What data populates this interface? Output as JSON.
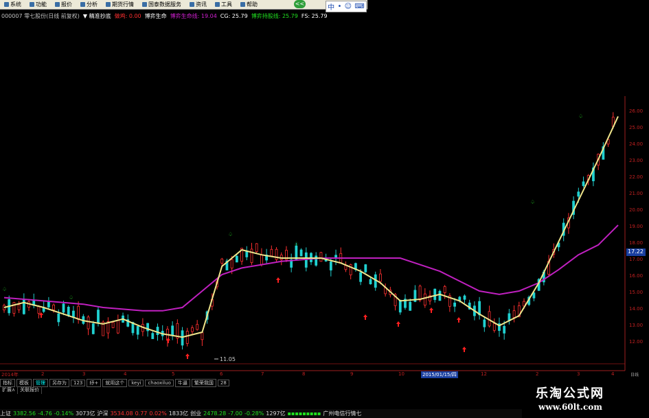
{
  "menu": {
    "items": [
      "系统",
      "功能",
      "报价",
      "分析",
      "期货行情",
      "国泰数据服务",
      "资讯",
      "工具",
      "帮助"
    ],
    "back_label": "<<",
    "ime": [
      "中",
      "•",
      "☺",
      "⌨"
    ]
  },
  "indicator_line": {
    "stock": "000007 零七股份(日线 前复权)",
    "items": [
      {
        "label": "▼ 精准抄底",
        "color": "#ffffff"
      },
      {
        "label": "做鸡: 0.00",
        "color": "#ff3030"
      },
      {
        "label": "博弈生命",
        "color": "#ffffff"
      },
      {
        "label": "博弈生命线: 19.04",
        "color": "#d020d0"
      },
      {
        "label": "CG: 25.79",
        "color": "#ffffff"
      },
      {
        "label": "博弈持股线: 25.79",
        "color": "#20e020"
      },
      {
        "label": "FS: 25.79",
        "color": "#ffffff"
      }
    ]
  },
  "price_axis": {
    "ticks": [
      "26.00",
      "25.00",
      "24.00",
      "23.00",
      "22.00",
      "21.00",
      "20.00",
      "19.00",
      "18.00",
      "17.00",
      "16.00",
      "15.00",
      "14.00",
      "13.00",
      "12.00"
    ],
    "current": "17.22"
  },
  "date_axis": {
    "labels": [
      "2014年",
      "2",
      "3",
      "4",
      "5",
      "6",
      "7",
      "8",
      "9",
      "10",
      "11",
      "12",
      "2",
      "3",
      "4"
    ],
    "cursor": "2015/01/15/四",
    "right": "日线"
  },
  "low_label": "11.05",
  "toolbar": {
    "items": [
      "指标",
      "模板",
      "管理",
      "另存为",
      "123",
      "纾+",
      "就用这个",
      "keyi",
      "chaoxiluo",
      "牛逼",
      "繁荣我国",
      "28"
    ],
    "selected": "管理"
  },
  "tabs2": [
    "扩展∧",
    "关联报价"
  ],
  "status": {
    "sh_label": "上证",
    "sh_val": "3382.56",
    "sh_chg": "-4.76",
    "sh_pct": "-0.14%",
    "sh_amt": "3073亿",
    "hs_label": "沪深",
    "hs_val": "3534.08",
    "hs_chg": "0.77",
    "hs_pct": "0.02%",
    "hs_amt": "1833亿",
    "cy_label": "创业",
    "cy_val": "2478.28",
    "cy_chg": "-7.00",
    "cy_pct": "-0.28%",
    "cy_amt": "1297亿",
    "news": "广州电信行情七"
  },
  "watermark": {
    "title": "乐淘公式网",
    "url": "www.60lt.com"
  },
  "colors": {
    "up": "#ff3030",
    "down": "#20e020",
    "ma_yellow": "#f0e68c",
    "life_line": "#c020c0",
    "arrow_up": "#ff2020",
    "arrow_top": "#20c020"
  },
  "chart_data": {
    "type": "candlestick",
    "life_line": [
      14.6,
      14.5,
      14.4,
      14.3,
      14.2,
      14.0,
      13.9,
      13.8,
      13.8,
      14.0,
      15.0,
      16.0,
      16.4,
      16.6,
      16.8,
      16.9,
      17.0,
      17.0,
      17.0,
      17.0,
      17.0,
      16.6,
      16.2,
      15.6,
      15.0,
      14.8,
      15.0,
      15.5,
      16.3,
      17.2,
      17.8,
      19.0
    ],
    "ma_line": [
      14.0,
      14.3,
      14.0,
      13.6,
      13.2,
      13.0,
      13.3,
      12.8,
      12.4,
      12.2,
      12.5,
      16.5,
      17.5,
      17.2,
      17.0,
      17.0,
      17.0,
      16.7,
      16.2,
      15.5,
      14.4,
      14.5,
      14.8,
      14.4,
      13.6,
      12.9,
      13.5,
      15.5,
      18.0,
      20.5,
      23.0,
      25.6
    ]
  }
}
